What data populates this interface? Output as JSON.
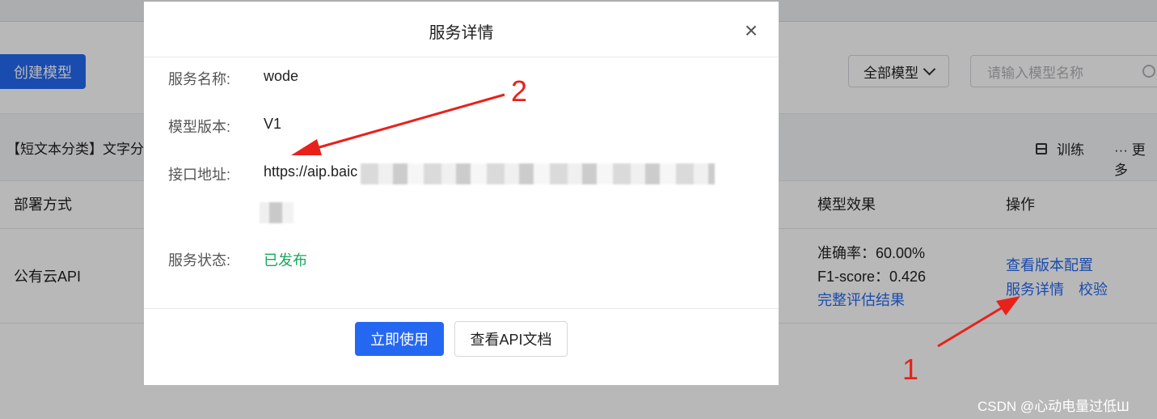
{
  "toolbar": {
    "create_label": "创建模型",
    "filter_value": "全部模型",
    "search_placeholder": "请输入模型名称"
  },
  "card": {
    "title": "【短文本分类】文字分",
    "train_label": "训练",
    "more_label": "··· 更多"
  },
  "table": {
    "headers": {
      "deploy": "部署方式",
      "effect": "模型效果",
      "actions": "操作"
    },
    "row": {
      "deploy": "公有云API",
      "accuracy": "准确率：60.00%",
      "f1": "F1-score：0.426",
      "eval_link": "完整评估结果",
      "action_view_config": "查看版本配置",
      "action_service_detail": "服务详情",
      "action_verify": "校验"
    }
  },
  "modal": {
    "title": "服务详情",
    "fields": {
      "name_label": "服务名称:",
      "name_value": "wode",
      "version_label": "模型版本:",
      "version_value": "V1",
      "endpoint_label": "接口地址:",
      "endpoint_value": "https://aip.baic",
      "status_label": "服务状态:",
      "status_value": "已发布"
    },
    "buttons": {
      "use_now": "立即使用",
      "view_api_doc": "查看API文档"
    }
  },
  "annotations": {
    "marker_1": "1",
    "marker_2": "2",
    "color": "#e8221b"
  },
  "watermark": "CSDN @心动电量过低Ш",
  "colors": {
    "primary": "#2468f2",
    "success": "#16a85a"
  }
}
